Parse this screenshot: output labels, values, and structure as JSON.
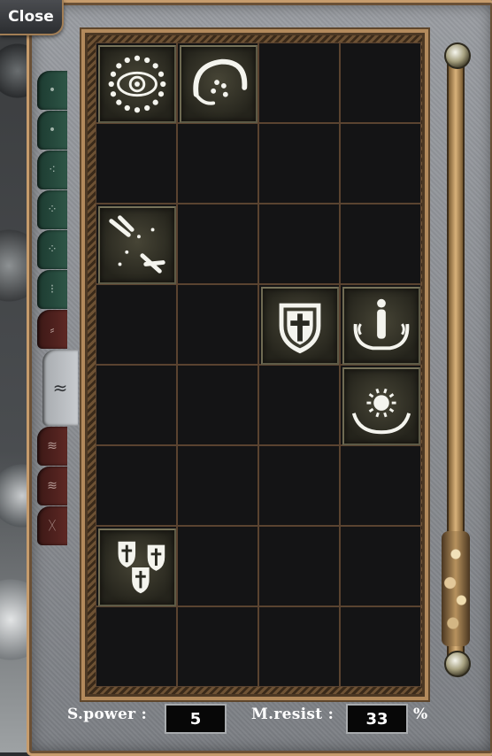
{
  "window": {
    "close_label": "Close"
  },
  "side_tabs": [
    {
      "name": "tab-1",
      "glyph": "•",
      "color": "green"
    },
    {
      "name": "tab-2",
      "glyph": "•",
      "color": "green"
    },
    {
      "name": "tab-3",
      "glyph": "⁖",
      "color": "green"
    },
    {
      "name": "tab-4",
      "glyph": "⁘",
      "color": "green"
    },
    {
      "name": "tab-5",
      "glyph": "⁘",
      "color": "green"
    },
    {
      "name": "tab-6",
      "glyph": "⁝",
      "color": "green"
    },
    {
      "name": "tab-7",
      "glyph": "⸗",
      "color": "red"
    },
    {
      "name": "tab-8",
      "glyph": "≈",
      "color": "active"
    },
    {
      "name": "tab-9",
      "glyph": "≋",
      "color": "red"
    },
    {
      "name": "tab-10",
      "glyph": "≋",
      "color": "red"
    },
    {
      "name": "tab-11",
      "glyph": "ᚷ",
      "color": "red"
    }
  ],
  "skills": [
    {
      "row": 0,
      "col": 0,
      "icon": "radiant-eye-icon"
    },
    {
      "row": 0,
      "col": 1,
      "icon": "crescent-dots-icon"
    },
    {
      "row": 2,
      "col": 0,
      "icon": "chains-icon"
    },
    {
      "row": 3,
      "col": 2,
      "icon": "cross-shield-icon"
    },
    {
      "row": 3,
      "col": 3,
      "icon": "raised-figure-icon"
    },
    {
      "row": 4,
      "col": 3,
      "icon": "sun-cradle-icon"
    },
    {
      "row": 6,
      "col": 0,
      "icon": "triple-shields-icon"
    }
  ],
  "stats": {
    "spower_label": "S.power :",
    "spower_value": "5",
    "mresist_label": "M.resist :",
    "mresist_value": "33",
    "mresist_unit": "%"
  },
  "colors": {
    "frame_border": "#c69c6d",
    "cell_bg": "#141415",
    "tab_green": "#2e5647",
    "tab_red": "#5e2824"
  }
}
